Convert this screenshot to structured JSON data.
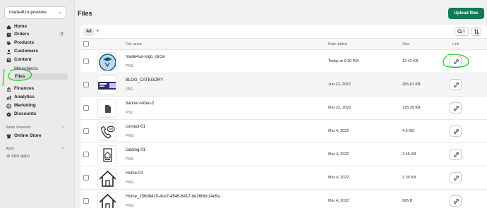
{
  "store": {
    "name": "made4Uo-preview"
  },
  "sidebar": {
    "items": [
      {
        "label": "Home",
        "icon": "home-icon"
      },
      {
        "label": "Orders",
        "icon": "orders-icon",
        "badge": "3"
      },
      {
        "label": "Products",
        "icon": "tag-icon"
      },
      {
        "label": "Customers",
        "icon": "person-icon"
      },
      {
        "label": "Content",
        "icon": "content-icon"
      }
    ],
    "content_sub": [
      {
        "label": "Metaobjects"
      },
      {
        "label": "Files",
        "active": true
      }
    ],
    "items2": [
      {
        "label": "Finances",
        "icon": "bank-icon"
      },
      {
        "label": "Analytics",
        "icon": "chart-icon"
      },
      {
        "label": "Marketing",
        "icon": "target-icon"
      },
      {
        "label": "Discounts",
        "icon": "discount-icon"
      }
    ],
    "sales_channels_title": "Sales channels",
    "online_store": "Online Store",
    "apps_title": "Apps",
    "add_apps": "Add apps"
  },
  "header": {
    "title": "Files",
    "upload_label": "Upload files"
  },
  "tabs": {
    "all": "All",
    "add": "+"
  },
  "table": {
    "columns": {
      "name": "File name",
      "date": "Date added",
      "size": "Size",
      "link": "Link"
    },
    "rows": [
      {
        "name": "made4uo-logo_circle",
        "type": "PNG",
        "date": "Today at 5:30 PM",
        "size": "12.42 KB",
        "thumb": "logo"
      },
      {
        "name": "BLOG_CATEGORY",
        "type": "JPG",
        "date": "Jun 22, 2022",
        "size": "265.61 KB",
        "thumb": "blog"
      },
      {
        "name": "banner-video-2",
        "type": "PSD",
        "date": "Mar 22, 2022",
        "size": "725.39 KB",
        "thumb": "doc"
      },
      {
        "name": "contact-01",
        "type": "PNG",
        "date": "Mar 4, 2022",
        "size": "4.5 KB",
        "thumb": "phone"
      },
      {
        "name": "catalog-01",
        "type": "PNG",
        "date": "Mar 4, 2022",
        "size": "2.46 KB",
        "thumb": "catalog"
      },
      {
        "name": "Home-01",
        "type": "PNG",
        "date": "Mar 4, 2022",
        "size": "3.39 KB",
        "thumb": "house"
      },
      {
        "name": "Home_156d8410-4ce7-4546-8417-de26b6c14e5a",
        "type": "PNG",
        "date": "Mar 4, 2022",
        "size": "995 B",
        "thumb": "house"
      }
    ]
  },
  "colors": {
    "primary_button": "#137a55",
    "annotation": "#1ec71e"
  }
}
